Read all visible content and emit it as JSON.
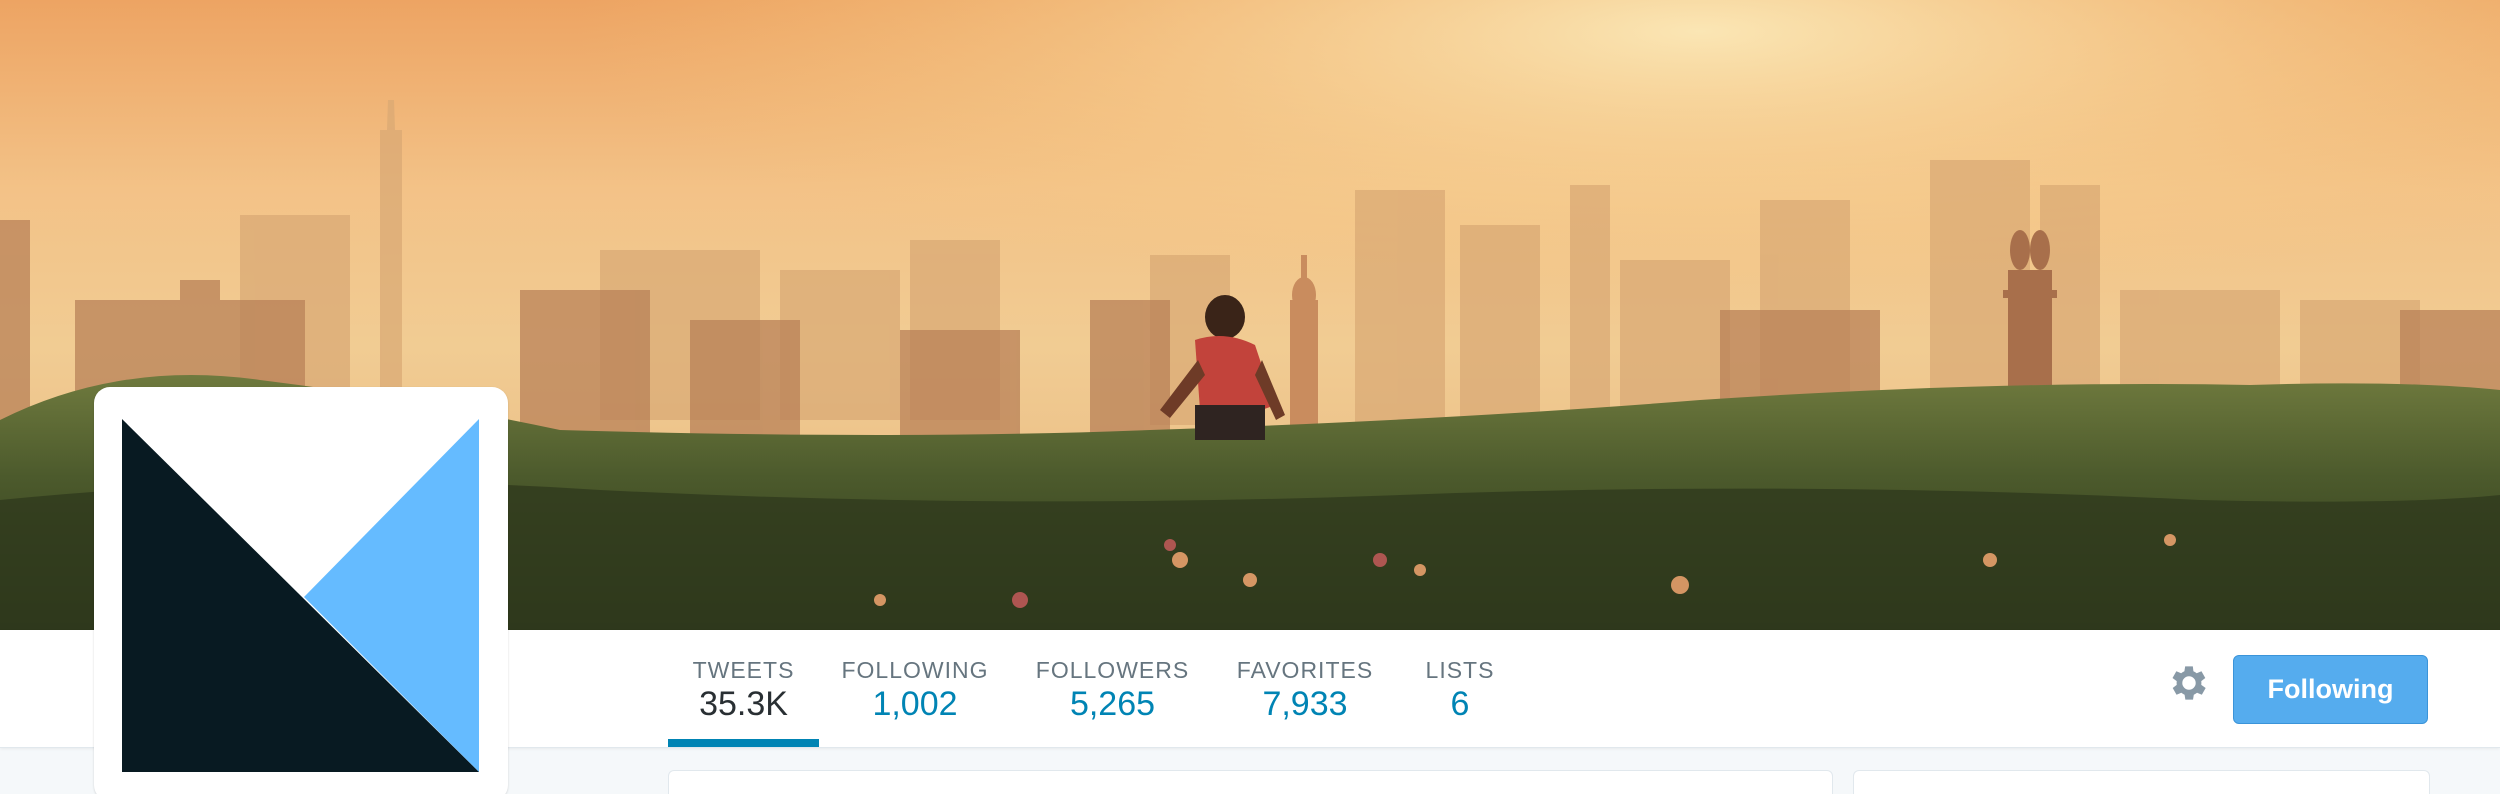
{
  "profile": {
    "avatar_logo": "medium-m-logo",
    "colors": {
      "logo_dark": "#081a22",
      "logo_light": "#65bbff",
      "accent": "#0084b4",
      "button": "#55acee"
    }
  },
  "banner": {
    "image": "city-skyline-at-sunset-with-running-boy"
  },
  "nav": {
    "stats": [
      {
        "label": "TWEETS",
        "value": "35.3K",
        "active": true
      },
      {
        "label": "FOLLOWING",
        "value": "1,002",
        "active": false
      },
      {
        "label": "FOLLOWERS",
        "value": "5,265",
        "active": false
      },
      {
        "label": "FAVORITES",
        "value": "7,933",
        "active": false
      },
      {
        "label": "LISTS",
        "value": "6",
        "active": false
      }
    ],
    "settings_icon": "gear-icon",
    "follow_button_label": "Following"
  }
}
